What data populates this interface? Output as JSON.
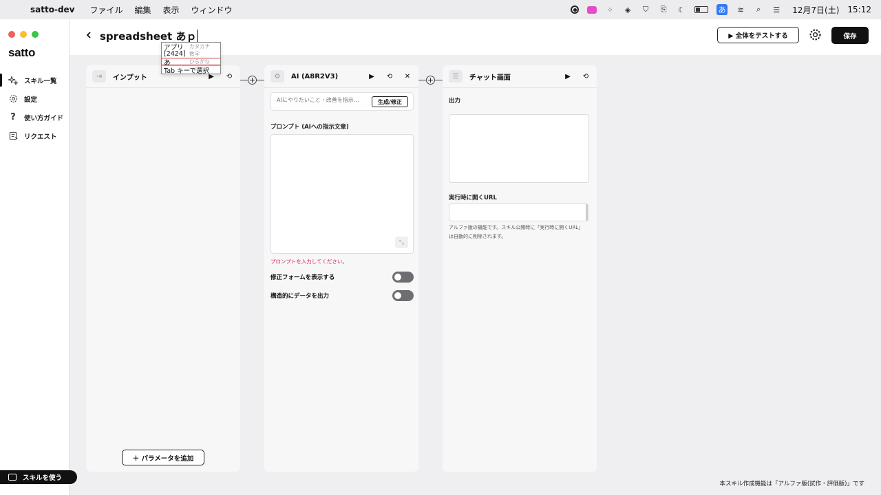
{
  "menubar": {
    "app_name": "satto-dev",
    "menus": [
      "ファイル",
      "編集",
      "表示",
      "ウィンドウ"
    ],
    "ime_indicator": "あ",
    "date": "12月7日(土)",
    "time": "15:12"
  },
  "sidebar": {
    "logo": "satto",
    "items": [
      {
        "label": "スキル一覧",
        "icon": "sparkle-icon",
        "active": true
      },
      {
        "label": "設定",
        "icon": "gear-icon",
        "active": false
      },
      {
        "label": "使い方ガイド",
        "icon": "question-icon",
        "active": false
      },
      {
        "label": "リクエスト",
        "icon": "request-icon",
        "active": false
      }
    ],
    "use_skill_label": "スキルを使う"
  },
  "header": {
    "title": "spreadsheet あｐ",
    "test_all_label": "▶ 全体をテストする",
    "save_label": "保存"
  },
  "ime": {
    "candidates": [
      {
        "kana": "アプリ",
        "hint": "カタカナ"
      },
      {
        "kana": "[2424]",
        "hint": "数字"
      },
      {
        "kana": "あ",
        "hint": "ひらがな"
      }
    ],
    "tab_hint": "Tab キーで選択"
  },
  "panels": {
    "input": {
      "title": "インプット",
      "add_param_label": "＋ パラメータを追加"
    },
    "ai": {
      "title": "AI (A8R2V3)",
      "ai_input_placeholder": "AIにやりたいこと・改善を指示…",
      "generate_label": "生成/修正",
      "prompt_label": "プロンプト (AIへの指示文章)",
      "prompt_error": "プロンプトを入力してください。",
      "toggle_form_label": "修正フォームを表示する",
      "toggle_struct_label": "構造的にデータを出力"
    },
    "chat": {
      "title": "チャット画面",
      "output_label": "出力",
      "url_label": "実行時に開くURL",
      "url_note": "アルファ版の機能です。スキル公開時に「実行時に開くURL」は自動的に削除されます。"
    }
  },
  "footer_note": "本スキル作成機能は「アルファ版(試作・評価版)」です"
}
